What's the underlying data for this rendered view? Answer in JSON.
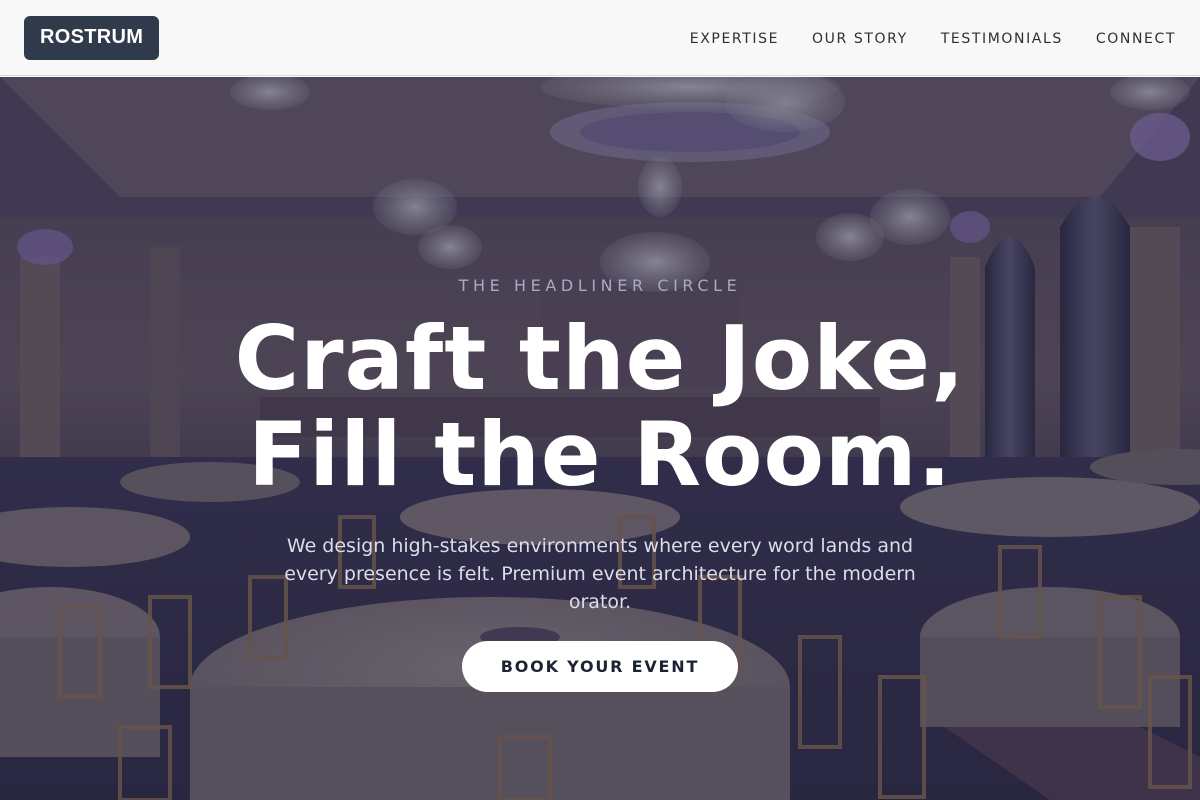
{
  "header": {
    "logo": "ROSTRUM",
    "nav": [
      {
        "label": "EXPERTISE"
      },
      {
        "label": "OUR STORY"
      },
      {
        "label": "TESTIMONIALS"
      },
      {
        "label": "CONNECT"
      }
    ]
  },
  "hero": {
    "eyebrow": "THE HEADLINER CIRCLE",
    "headline_line1": "Craft the Joke,",
    "headline_line2": "Fill the Room.",
    "subtext": "We design high-stakes environments where every word lands and every presence is felt. Premium event architecture for the modern orator.",
    "cta_label": "BOOK YOUR EVENT"
  },
  "colors": {
    "header_bg": "#f8f8f8",
    "logo_bg": "#2f3a4a",
    "overlay": "#282640",
    "cta_bg": "#ffffff",
    "cta_text": "#1b2333"
  }
}
